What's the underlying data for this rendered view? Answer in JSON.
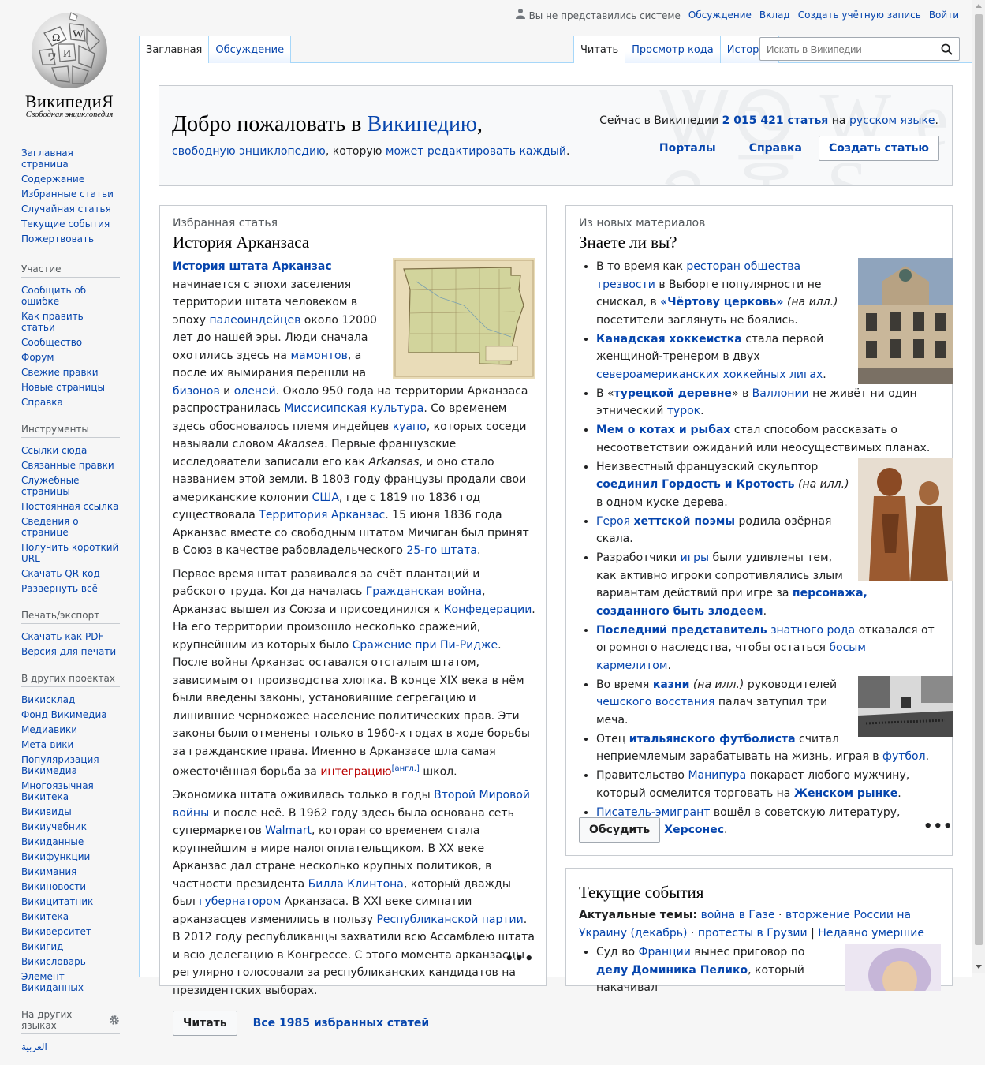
{
  "logo": {
    "wordmark": "ВикипедиЯ",
    "tagline": "Свободная энциклопедия"
  },
  "header": {
    "anon": "Вы не представились системе",
    "links": [
      "Обсуждение",
      "Вклад",
      "Создать учётную запись",
      "Войти"
    ]
  },
  "tabs": {
    "left": [
      "Заглавная",
      "Обсуждение"
    ],
    "right": [
      "Читать",
      "Просмотр кода",
      "История"
    ]
  },
  "search": {
    "placeholder": "Искать в Википедии"
  },
  "sidebar": {
    "nav": [
      "Заглавная страница",
      "Содержание",
      "Избранные статьи",
      "Случайная статья",
      "Текущие события",
      "Пожертвовать"
    ],
    "participation": {
      "title": "Участие",
      "items": [
        "Сообщить об ошибке",
        "Как править статьи",
        "Сообщество",
        "Форум",
        "Свежие правки",
        "Новые страницы",
        "Справка"
      ]
    },
    "tools": {
      "title": "Инструменты",
      "items": [
        "Ссылки сюда",
        "Связанные правки",
        "Служебные страницы",
        "Постоянная ссылка",
        "Сведения о странице",
        "Получить короткий URL",
        "Скачать QR-код",
        "Развернуть всё"
      ]
    },
    "print": {
      "title": "Печать/экспорт",
      "items": [
        "Скачать как PDF",
        "Версия для печати"
      ]
    },
    "projects": {
      "title": "В других проектах",
      "items": [
        "Викисклад",
        "Фонд Викимедиа",
        "Медиавики",
        "Мета-вики",
        "Популяризация Викимедиа",
        "Многоязычная Викитека",
        "Викивиды",
        "Викиучебник",
        "Викиданные",
        "Викифункции",
        "Викимания",
        "Викиновости",
        "Викицитатник",
        "Викитека",
        "Викиверситет",
        "Викигид",
        "Викисловарь",
        "Элемент Викиданных"
      ]
    },
    "languages": {
      "title": "На других языках",
      "first": "العربية"
    }
  },
  "welcome": {
    "title_a": "Добро пожаловать в ",
    "title_link": "Википедию",
    "title_b": ",",
    "sub_link1": "свободную энциклопедию",
    "sub_mid": ", которую ",
    "sub_link2": "может редактировать каждый",
    "sub_end": ".",
    "stats_a": "Сейчас в Википедии ",
    "stats_count": "2 015 421 статья",
    "stats_b": " на ",
    "stats_lang": "русском языке",
    "stats_end": ".",
    "portals": "Порталы",
    "help": "Справка",
    "create": "Создать статью",
    "bg": "ᏔᏫ ᎠᏍ ᎤᏓ\nคฺพฺ 홀ㅇ Ꮥ"
  },
  "featured": {
    "kicker": "Избранная статья",
    "title": "История Арканзаса",
    "read": "Читать",
    "all": "Все 1985 избранных статей",
    "more": "•••"
  },
  "dyk": {
    "kicker": "Из новых материалов",
    "title": "Знаете ли вы?",
    "discuss": "Обсудить",
    "more": "•••"
  },
  "events": {
    "title": "Текущие события",
    "topics_label": "Актуальные темы:",
    "topic1": "война в Газе",
    "topic2": "вторжение России на Украину (декабрь)",
    "topic3": "протесты в Грузии",
    "recent": "Недавно умершие",
    "item_a": "Суд во ",
    "item_link1": "Франции",
    "item_b": " вынес приговор по ",
    "item_link2": "делу Доминика Пелико",
    "item_c": ", который накачивал"
  }
}
